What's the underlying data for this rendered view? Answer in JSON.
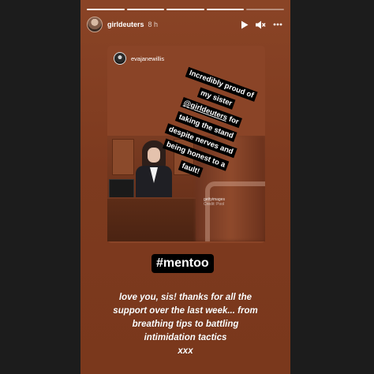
{
  "story": {
    "progress": {
      "total_segments": 5,
      "completed_segments": 4
    },
    "header": {
      "username": "girldeuters",
      "time": "8 h",
      "controls": [
        "play-icon",
        "mute-icon",
        "more-icon"
      ]
    },
    "shared_post": {
      "username": "evajanewillis",
      "caption_lines": [
        "Incredibly proud of",
        "my sister",
        "@girldeuters",
        "for",
        "taking the stand",
        "despite nerves and",
        "being honest to a",
        "fault!"
      ],
      "watermark_lines": [
        "gettyimages",
        "Credit: Pool"
      ]
    },
    "tag": "#mentoo",
    "message_lines": [
      "love you, sis! thanks for all the",
      "support over the last week... from",
      "breathing tips to battling",
      "intimidation tactics",
      "xxx"
    ],
    "colors": {
      "background": "#7d3a1f",
      "sticker": "#000000",
      "text": "#ffffff"
    }
  }
}
